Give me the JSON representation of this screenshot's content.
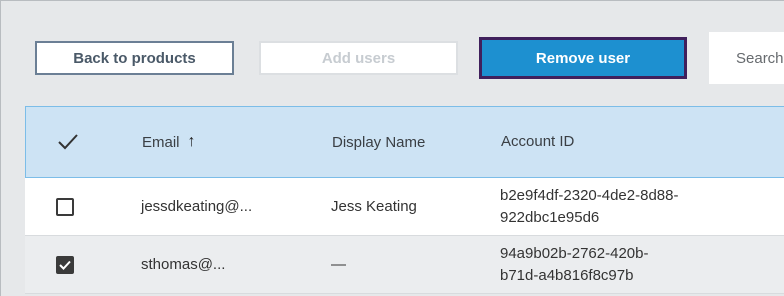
{
  "toolbar": {
    "back_label": "Back to products",
    "add_label": "Add users",
    "remove_label": "Remove user",
    "search_placeholder": "Search"
  },
  "table": {
    "headers": {
      "select_all_icon": "checkmark-icon",
      "email": "Email",
      "email_sort_icon": "arrow-up-icon",
      "display_name": "Display Name",
      "account_id": "Account ID"
    },
    "rows": [
      {
        "checked": false,
        "email": "jessdkeating@...",
        "display_name": "Jess Keating",
        "account_id_line1": "b2e9f4df-2320-4de2-8d88-",
        "account_id_line2": "922dbc1e95d6"
      },
      {
        "checked": true,
        "email": "sthomas@...",
        "display_name": "—",
        "account_id_line1": "94a9b02b-2762-420b-",
        "account_id_line2": "b71d-a4b816f8c97b"
      }
    ]
  },
  "colors": {
    "primary": "#1d90d0",
    "focus_ring": "#40205c",
    "header_bg": "#cde3f4"
  }
}
